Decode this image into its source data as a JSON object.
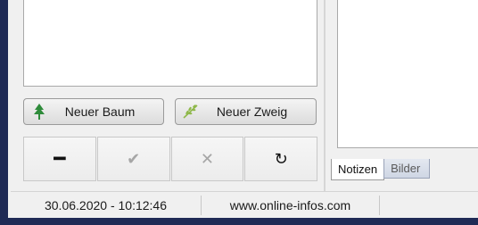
{
  "buttons": {
    "new_tree": "Neuer Baum",
    "new_branch": "Neuer Zweig"
  },
  "icons": {
    "tree": "tree-icon",
    "branch": "branch-icon",
    "minus": "minus-icon",
    "check": "check-icon",
    "cancel": "cancel-icon",
    "refresh": "refresh-icon"
  },
  "tool_glyphs": {
    "minus": "━",
    "check": "✔",
    "cancel": "✕",
    "refresh": "↻"
  },
  "tabs": [
    {
      "label": "Notizen",
      "active": true
    },
    {
      "label": "Bilder",
      "active": false
    }
  ],
  "status": {
    "datetime": "30.06.2020 - 10:12:46",
    "website": "www.online-infos.com"
  },
  "colors": {
    "window_frame": "#1f2a55",
    "tree_green": "#2e8b3a",
    "branch_green": "#8fb84a"
  }
}
